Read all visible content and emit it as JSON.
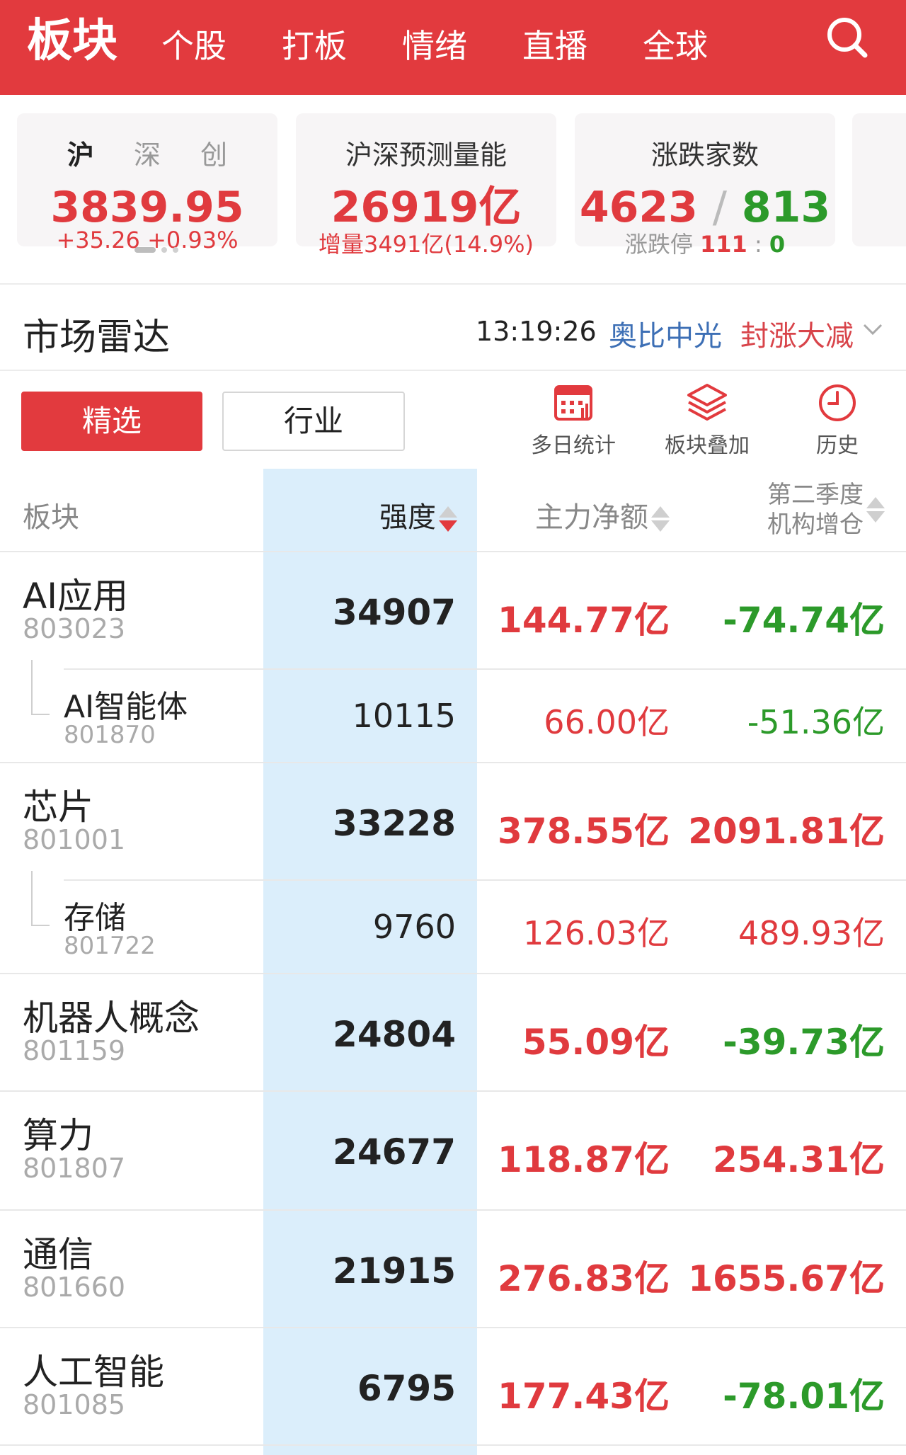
{
  "nav": {
    "active": "板块",
    "items": [
      "个股",
      "打板",
      "情绪",
      "直播",
      "全球"
    ]
  },
  "cards": [
    {
      "tabs": [
        "沪",
        "深",
        "创"
      ],
      "value": "3839.95",
      "change": "+35.26",
      "change_pct": "+0.93%"
    },
    {
      "title": "沪深预测量能",
      "value": "26919亿",
      "sub": "增量3491亿(14.9%)"
    },
    {
      "title": "涨跌家数",
      "up": "4623",
      "sep": "/",
      "down": "813",
      "sub_label": "涨跌停",
      "limit_up": "111",
      "limit_sep": ":",
      "limit_down": "0"
    }
  ],
  "radar": {
    "title": "市场雷达",
    "time": "13:19:26",
    "link1": "奥比中光",
    "link2": "封涨大减"
  },
  "filters": {
    "selected": "精选",
    "industry": "行业"
  },
  "tools": [
    {
      "label": "多日统计",
      "icon": "calendar-chart-icon"
    },
    {
      "label": "板块叠加",
      "icon": "layers-icon"
    },
    {
      "label": "历史",
      "icon": "clock-icon"
    }
  ],
  "table": {
    "headers": {
      "sector": "板块",
      "strength": "强度",
      "net": "主力净额",
      "inst_line1": "第二季度",
      "inst_line2": "机构增仓"
    },
    "rows": [
      {
        "name": "AI应用",
        "code": "803023",
        "strength": "34907",
        "net": "144.77亿",
        "inst": "-74.74亿"
      },
      {
        "name": "AI智能体",
        "code": "801870",
        "strength": "10115",
        "net": "66.00亿",
        "inst": "-51.36亿"
      },
      {
        "name": "芯片",
        "code": "801001",
        "strength": "33228",
        "net": "378.55亿",
        "inst": "2091.81亿"
      },
      {
        "name": "存储",
        "code": "801722",
        "strength": "9760",
        "net": "126.03亿",
        "inst": "489.93亿"
      },
      {
        "name": "机器人概念",
        "code": "801159",
        "strength": "24804",
        "net": "55.09亿",
        "inst": "-39.73亿"
      },
      {
        "name": "算力",
        "code": "801807",
        "strength": "24677",
        "net": "118.87亿",
        "inst": "254.31亿"
      },
      {
        "name": "通信",
        "code": "801660",
        "strength": "21915",
        "net": "276.83亿",
        "inst": "1655.67亿"
      },
      {
        "name": "人工智能",
        "code": "801085",
        "strength": "6795",
        "net": "177.43亿",
        "inst": "-78.01亿"
      }
    ]
  },
  "colors": {
    "brand_red": "#e23a3e",
    "up_red": "#e03a3e",
    "down_green": "#2c9a2a",
    "link_blue": "#3d6fb5",
    "strength_bg": "#dbeefb"
  }
}
